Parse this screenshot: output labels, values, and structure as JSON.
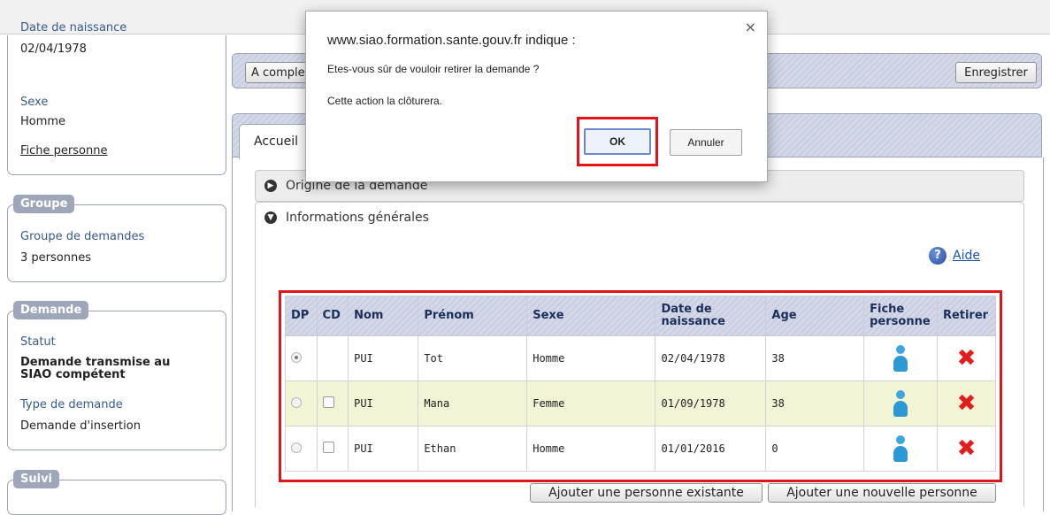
{
  "left": {
    "person": {
      "birth_label": "Date de naissance",
      "birth_value": "02/04/1978",
      "sex_label": "Sexe",
      "sex_value": "Homme",
      "fiche_link": "Fiche personne"
    },
    "groupe": {
      "legend": "Groupe",
      "label": "Groupe de demandes",
      "value": "3 personnes"
    },
    "demande": {
      "legend": "Demande",
      "statut_label": "Statut",
      "statut_value_line1": "Demande transmise au",
      "statut_value_line2": "SIAO compétent",
      "type_label": "Type de demande",
      "type_value": "Demande d'insertion"
    },
    "suivi": {
      "legend": "Suivi"
    }
  },
  "header": {
    "status_button": "A comple",
    "save_button": "Enregistrer"
  },
  "tabs": {
    "accueil": "Accueil"
  },
  "sections": {
    "origine": "Origine de la demande",
    "infos": "Informations générales"
  },
  "aide": {
    "icon": "help-icon",
    "label": "Aide"
  },
  "table": {
    "headers": [
      "DP",
      "CD",
      "Nom",
      "Prénom",
      "Sexe",
      "Date de naissance",
      "Age",
      "Fiche personne",
      "Retirer"
    ],
    "rows": [
      {
        "dp_checked": true,
        "cd": false,
        "nom": "PUI",
        "prenom": "Tot",
        "sexe": "Homme",
        "naissance": "02/04/1978",
        "age": "38"
      },
      {
        "dp_checked": false,
        "cd": true,
        "nom": "PUI",
        "prenom": "Mana",
        "sexe": "Femme",
        "naissance": "01/09/1978",
        "age": "38"
      },
      {
        "dp_checked": false,
        "cd": true,
        "nom": "PUI",
        "prenom": "Ethan",
        "sexe": "Homme",
        "naissance": "01/01/2016",
        "age": "0"
      }
    ]
  },
  "actions": {
    "add_existing": "Ajouter une personne existante",
    "add_new": "Ajouter une nouvelle personne"
  },
  "dialog": {
    "title": "www.siao.formation.sante.gouv.fr indique :",
    "message1": "Etes-vous sûr de vouloir retirer la demande ?",
    "message2": "Cette action la clôturera.",
    "ok": "OK",
    "cancel": "Annuler",
    "close_icon": "×"
  },
  "colors": {
    "highlight": "#e0151b",
    "alt_row": "#f3f3d6",
    "header_text": "#1b2f5a",
    "link": "#1a4fb5"
  }
}
